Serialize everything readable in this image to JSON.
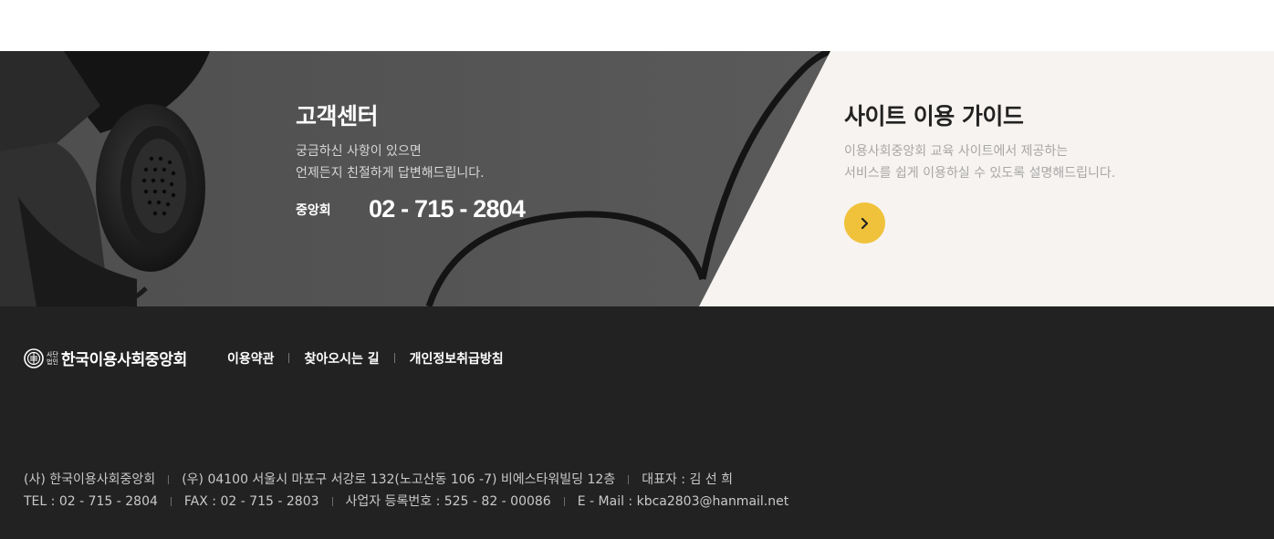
{
  "customer_center": {
    "title": "고객센터",
    "desc_line1": "궁금하신 사항이 있으면",
    "desc_line2": "언제든지 친절하게 답변해드립니다.",
    "phone_label": "중앙회",
    "phone_number": "02 - 715 - 2804"
  },
  "guide": {
    "title": "사이트 이용 가이드",
    "desc_line1": "이용사회중앙회 교육 사이트에서 제공하는",
    "desc_line2": "서비스를 쉽게 이용하실 수 있도록 설명해드립니다.",
    "button_icon": "chevron-right-icon",
    "accent_color": "#f0c23b"
  },
  "footer": {
    "logo_small_top": "사단",
    "logo_small_bottom": "법인",
    "logo_text": "한국이용사회중앙회",
    "links": [
      "이용약관",
      "찾아오시는 길",
      "개인정보취급방침"
    ],
    "info_line1": [
      "(사) 한국이용사회중앙회",
      "(우) 04100 서울시 마포구 서강로 132(노고산동 106 -7) 비에스타워빌딩 12층",
      "대표자 : 김 선 희"
    ],
    "info_line2": [
      "TEL : 02 - 715 - 2804",
      "FAX : 02 - 715 - 2803",
      "사업자 등록번호 : 525 - 82 - 00086",
      "E - Mail : kbca2803@hanmail.net"
    ]
  }
}
